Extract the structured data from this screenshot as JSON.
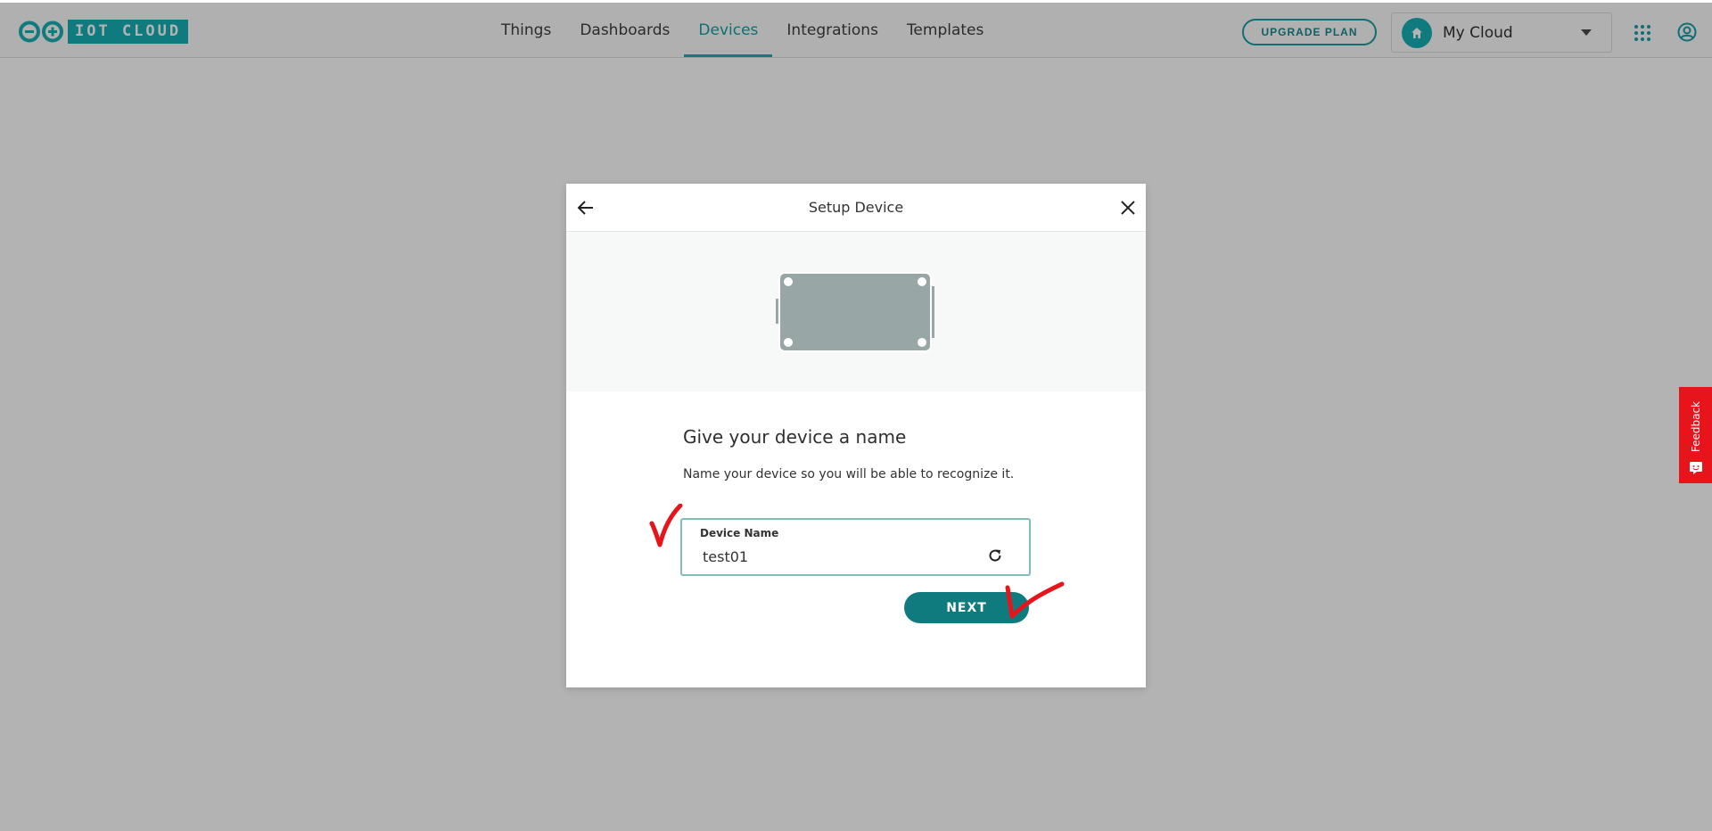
{
  "app": {
    "logo_text": "IOT CLOUD",
    "brand_color": "#0f7b7f"
  },
  "nav": {
    "items": [
      {
        "label": "Things"
      },
      {
        "label": "Dashboards"
      },
      {
        "label": "Devices",
        "active": true
      },
      {
        "label": "Integrations"
      },
      {
        "label": "Templates"
      }
    ]
  },
  "header": {
    "upgrade_label": "UPGRADE PLAN",
    "cloud_select_value": "My Cloud"
  },
  "dialog": {
    "title": "Setup Device",
    "heading": "Give your device a name",
    "subtitle": "Name your device so you will be able to recognize it.",
    "field": {
      "label": "Device Name",
      "value": "test01"
    },
    "next_label": "NEXT"
  },
  "feedback": {
    "label": "Feedback",
    "color": "#e8141c"
  },
  "icons": {
    "back": "arrow-left-icon",
    "close": "close-icon",
    "refresh": "refresh-icon",
    "apps": "grid-icon",
    "user": "user-icon",
    "home": "home-icon"
  }
}
